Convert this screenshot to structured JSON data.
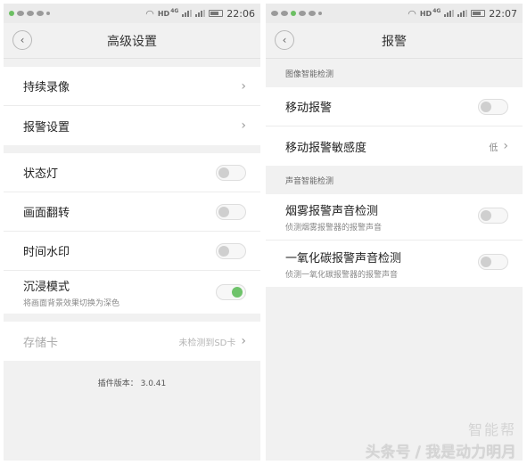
{
  "left": {
    "status": {
      "time": "22:06",
      "network": "HD",
      "net_gen": "4G"
    },
    "title": "高级设置",
    "items1": [
      {
        "label": "持续录像"
      },
      {
        "label": "报警设置"
      }
    ],
    "items2": [
      {
        "label": "状态灯",
        "on": false
      },
      {
        "label": "画面翻转",
        "on": false
      },
      {
        "label": "时间水印",
        "on": false
      },
      {
        "label": "沉浸模式",
        "sub": "将画面背景效果切换为深色",
        "on": true
      }
    ],
    "storage": {
      "label": "存储卡",
      "value": "未检测到SD卡"
    },
    "version": "插件版本： 3.0.41"
  },
  "right": {
    "status": {
      "time": "22:07",
      "network": "HD",
      "net_gen": "4G"
    },
    "title": "报警",
    "section1": "图像智能检测",
    "motion": {
      "label": "移动报警",
      "on": false
    },
    "sensitivity": {
      "label": "移动报警敏感度",
      "value": "低"
    },
    "section2": "声音智能检测",
    "smoke": {
      "label": "烟雾报警声音检测",
      "sub": "侦测烟雾报警器的报警声音",
      "on": false
    },
    "co": {
      "label": "一氧化碳报警声音检测",
      "sub": "侦测一氧化碳报警器的报警声音",
      "on": false
    }
  },
  "watermark": {
    "logo": "智能帮",
    "text": "头条号 / 我是动力明月"
  },
  "colors": {
    "toggle_on": "#6fc36b",
    "bg": "#f1f1f1"
  }
}
